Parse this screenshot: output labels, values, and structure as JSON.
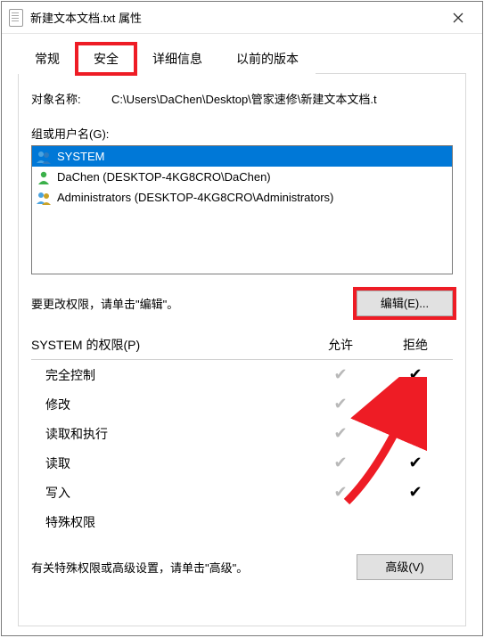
{
  "window": {
    "title": "新建文本文档.txt 属性"
  },
  "tabs": {
    "general": "常规",
    "security": "安全",
    "details": "详细信息",
    "previous": "以前的版本"
  },
  "object": {
    "label": "对象名称:",
    "path": "C:\\Users\\DaChen\\Desktop\\管家速修\\新建文本文档.t"
  },
  "groups": {
    "label": "组或用户名(G):",
    "items": [
      {
        "name": "SYSTEM"
      },
      {
        "name": "DaChen (DESKTOP-4KG8CRO\\DaChen)"
      },
      {
        "name": "Administrators (DESKTOP-4KG8CRO\\Administrators)"
      }
    ]
  },
  "edit": {
    "hint": "要更改权限，请单击\"编辑\"。",
    "button": "编辑(E)..."
  },
  "permissions": {
    "header_for": "SYSTEM 的权限(P)",
    "allow": "允许",
    "deny": "拒绝",
    "rows": [
      {
        "label": "完全控制",
        "allow": true,
        "deny": true
      },
      {
        "label": "修改",
        "allow": true,
        "deny": true
      },
      {
        "label": "读取和执行",
        "allow": true,
        "deny": true
      },
      {
        "label": "读取",
        "allow": true,
        "deny": true
      },
      {
        "label": "写入",
        "allow": true,
        "deny": true
      },
      {
        "label": "特殊权限",
        "allow": false,
        "deny": false
      }
    ]
  },
  "advanced": {
    "hint": "有关特殊权限或高级设置，请单击\"高级\"。",
    "button": "高级(V)"
  }
}
